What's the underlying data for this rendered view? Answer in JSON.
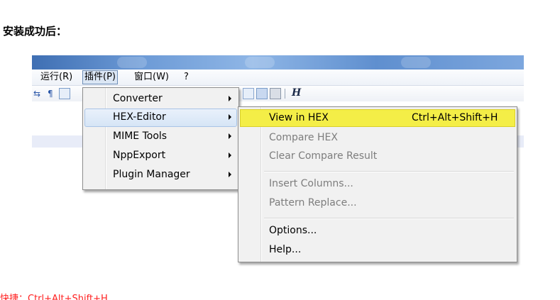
{
  "heading": "安装成功后：",
  "menubar": {
    "run": "运行(R)",
    "plugins": "插件(P)",
    "window": "窗口(W)",
    "help": "?"
  },
  "toolbar": {
    "h_label": "H"
  },
  "plugins_menu": {
    "items": [
      {
        "label": "Converter",
        "has_submenu": true
      },
      {
        "label": "HEX-Editor",
        "has_submenu": true,
        "highlighted": true
      },
      {
        "label": "MIME Tools",
        "has_submenu": true
      },
      {
        "label": "NppExport",
        "has_submenu": true
      },
      {
        "label": "Plugin Manager",
        "has_submenu": true
      }
    ]
  },
  "hex_menu": {
    "view_in_hex": {
      "label": "View in HEX",
      "shortcut": "Ctrl+Alt+Shift+H",
      "highlight_color": "#f4ee47"
    },
    "compare_hex": {
      "label": "Compare HEX",
      "enabled": false
    },
    "clear_compare": {
      "label": "Clear Compare Result",
      "enabled": false
    },
    "insert_columns": {
      "label": "Insert Columns...",
      "enabled": false
    },
    "pattern_replace": {
      "label": "Pattern Replace...",
      "enabled": false
    },
    "options": {
      "label": "Options..."
    },
    "help": {
      "label": "Help..."
    }
  },
  "note": "快捷：Ctrl+Alt+Shift+H",
  "colors": {
    "accent_highlight": "#f4ee47",
    "note_red": "#ff2222",
    "menu_bg": "#f1f1f1"
  }
}
